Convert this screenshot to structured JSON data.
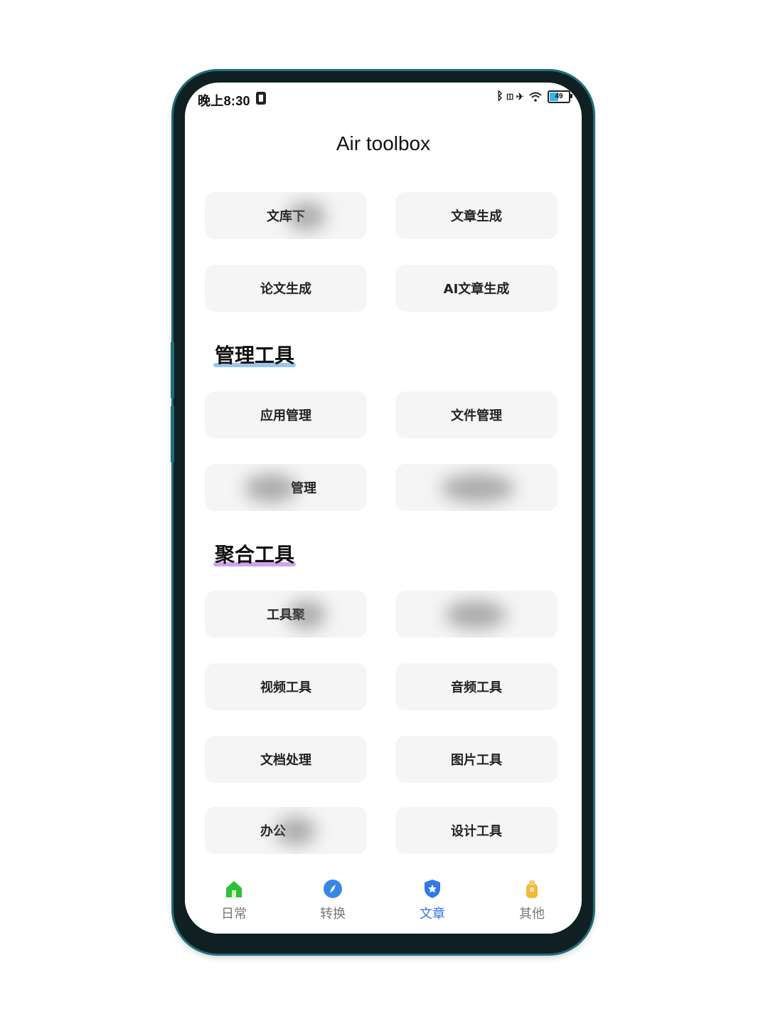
{
  "status_bar": {
    "time": "晚上8:30",
    "indicators": "ᛒ ◫ ✈",
    "battery": "49",
    "battery_level": 0.49,
    "wifi_icon": "wifi-icon"
  },
  "app": {
    "title": "Air toolbox"
  },
  "top_tools": [
    {
      "label": "文库下",
      "obscured": true
    },
    {
      "label": "文章生成"
    },
    {
      "label": "论文生成"
    },
    {
      "label": "AI文章生成"
    }
  ],
  "management": {
    "heading": "管理工具",
    "underline_color": "#7fb6ef",
    "tools": [
      {
        "label": "应用管理"
      },
      {
        "label": "文件管理"
      },
      {
        "label": "管理",
        "obscured": true
      },
      {
        "label": "",
        "obscured": true
      }
    ]
  },
  "aggregate": {
    "heading": "聚合工具",
    "underline_color": "#c58be8",
    "tools": [
      {
        "label": "工具聚",
        "obscured": true
      },
      {
        "label": "",
        "obscured": true
      },
      {
        "label": "视频工具"
      },
      {
        "label": "音频工具"
      },
      {
        "label": "文档处理"
      },
      {
        "label": "图片工具"
      },
      {
        "label": "办公",
        "obscured": true
      },
      {
        "label": "设计工具"
      }
    ]
  },
  "bottom_nav": {
    "active_index": 2,
    "active_color": "#3a74e6",
    "items": [
      {
        "label": "日常",
        "icon": "home-icon",
        "color": "#2fbf3a"
      },
      {
        "label": "转换",
        "icon": "compass-icon",
        "color": "#3a86e8"
      },
      {
        "label": "文章",
        "icon": "shield-star-icon",
        "color": "#2f7ae8"
      },
      {
        "label": "其他",
        "icon": "bag-icon",
        "color": "#f2b93b"
      }
    ]
  }
}
